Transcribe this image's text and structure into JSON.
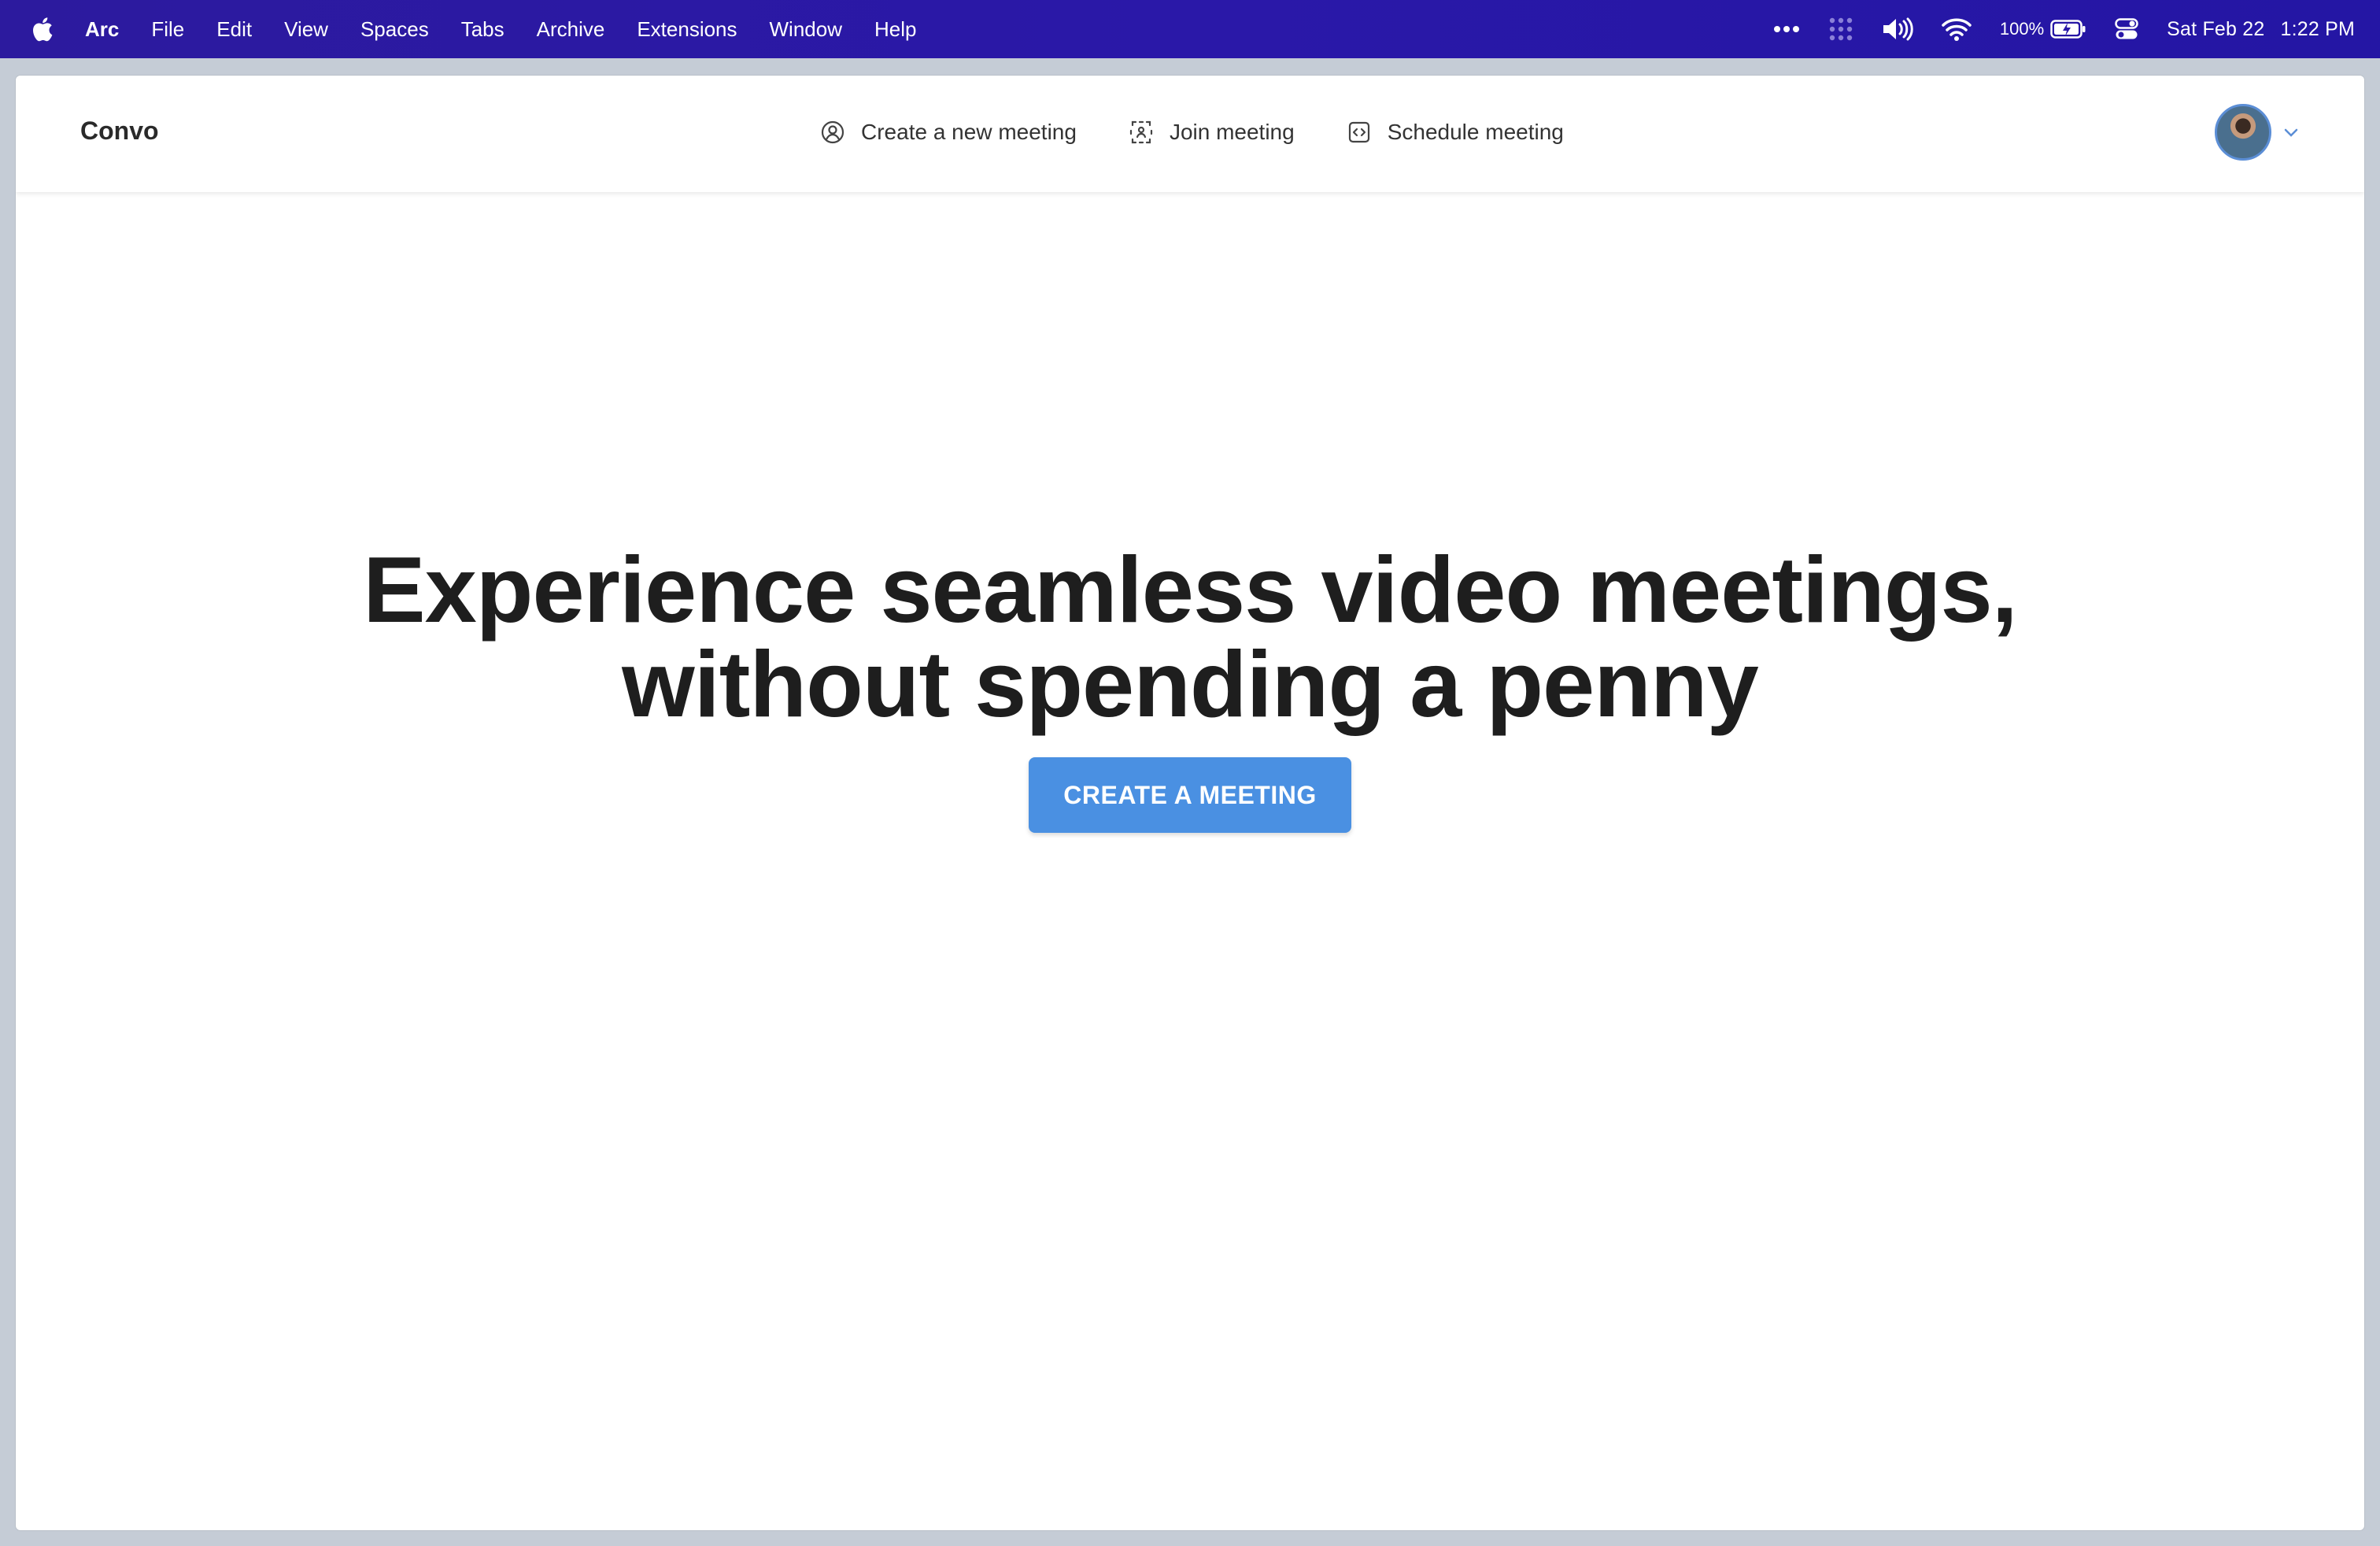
{
  "menubar": {
    "app_name": "Arc",
    "items": [
      "File",
      "Edit",
      "View",
      "Spaces",
      "Tabs",
      "Archive",
      "Extensions",
      "Window",
      "Help"
    ],
    "battery_percent": "100%",
    "date": "Sat Feb 22",
    "time": "1:22 PM"
  },
  "page": {
    "brand": "Convo",
    "nav": {
      "create": "Create a new meeting",
      "join": "Join meeting",
      "schedule": "Schedule meeting"
    },
    "hero": {
      "line1": "Experience seamless video meetings,",
      "line2": "without spending a penny",
      "cta": "CREATE A MEETING"
    }
  },
  "colors": {
    "menubar": "#2a18a8",
    "cta": "#4a90e2",
    "heading": "#1e1e1e"
  },
  "icons": {
    "menubar": [
      "apple-icon",
      "more-icon",
      "grid-icon",
      "volume-icon",
      "wifi-icon",
      "battery-icon",
      "control-center-icon"
    ],
    "nav": [
      "user-circle-icon",
      "join-frame-icon",
      "schedule-code-icon",
      "chevron-down-icon"
    ]
  }
}
